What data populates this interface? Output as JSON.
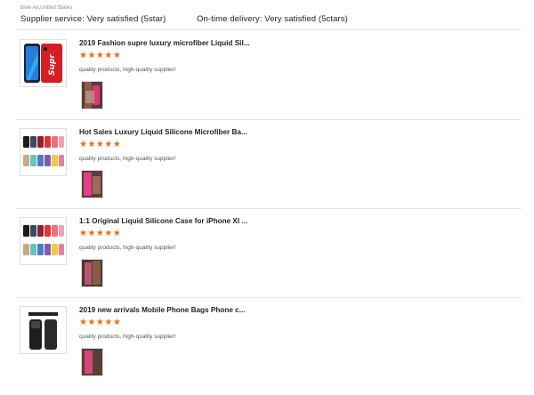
{
  "buyer": {
    "name_location": "dree An,United States"
  },
  "summary": {
    "supplier_service": "Supplier service: Very satisfied (5star)",
    "on_time_delivery": "On-time delivery: Very satisfied (5ctars)"
  },
  "reviews": [
    {
      "product_title": "2019 Fashion supre luxury microfiber Liquid Sil...",
      "rating": 5,
      "stars": "★★★★★",
      "comment": "quality products, high-quality supplier!",
      "thumb_icon": "red-phone-case-icon",
      "thumb_text": "Supr"
    },
    {
      "product_title": "Hot Sales Luxury Liquid Silicone Microfiber Ba...",
      "rating": 5,
      "stars": "★★★★★",
      "comment": "quality products, high-quality supplier!",
      "thumb_icon": "color-phone-cases-icon"
    },
    {
      "product_title": "1:1 Original Liquid Silicone Case for iPhone XI ...",
      "rating": 5,
      "stars": "★★★★★",
      "comment": "quality products, high-quality supplier!",
      "thumb_icon": "color-phone-cases-icon"
    },
    {
      "product_title": "2019 new arrivals Mobile Phone Bags Phone c...",
      "rating": 5,
      "stars": "★★★★★",
      "comment": "quality products, high-quality supplier!",
      "thumb_icon": "black-phone-cases-icon"
    }
  ],
  "colors": {
    "star": "#f26a10",
    "divider": "#e5e5e5"
  }
}
